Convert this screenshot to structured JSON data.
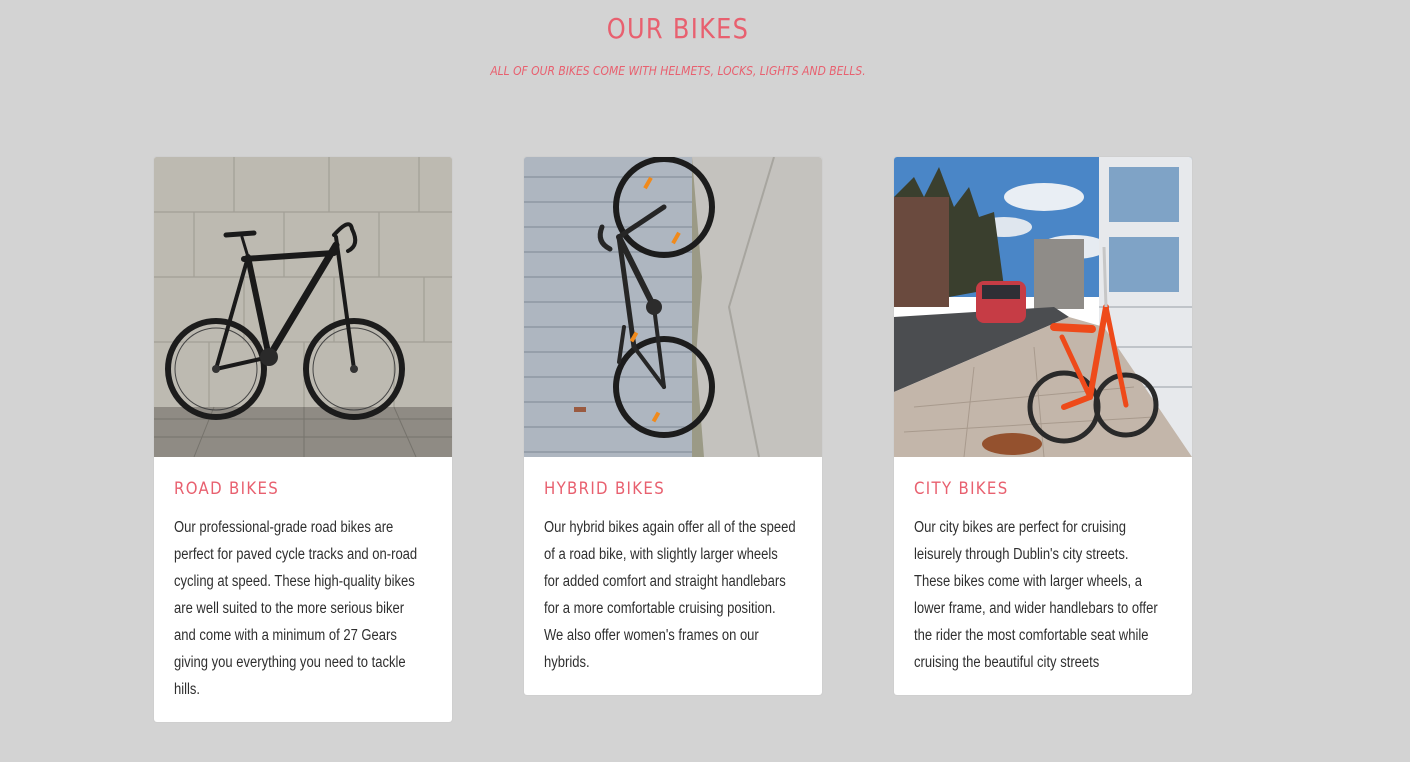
{
  "section": {
    "title": "OUR BIKES",
    "subtitle": "ALL OF OUR BIKES COME WITH HELMETS, LOCKS, LIGHTS AND BELLS."
  },
  "colors": {
    "accent": "#e8606f",
    "background": "#d3d3d3",
    "card": "#ffffff",
    "text": "#2f2f2f"
  },
  "cards": [
    {
      "image": "road-bike-photo",
      "title": "ROAD BIKES",
      "description": "Our professional-grade road bikes are perfect for paved cycle tracks and on-road cycling at speed. These high-quality bikes are well suited to the more serious biker and come with a minimum of 27 Gears giving you everything you need to tackle hills."
    },
    {
      "image": "hybrid-bike-photo",
      "title": "HYBRID BIKES",
      "description": "Our hybrid bikes again offer all of the speed of a road bike, with slightly larger wheels for added comfort and straight handlebars for a more comfortable cruising position. We also offer women's frames on our hybrids."
    },
    {
      "image": "city-bike-photo",
      "title": "CITY BIKES",
      "description": "Our city bikes are perfect for cruising leisurely through Dublin's city streets. These bikes come with larger wheels, a lower frame, and wider handlebars to offer the rider the most comfortable seat while cruising the beautiful city streets"
    }
  ]
}
